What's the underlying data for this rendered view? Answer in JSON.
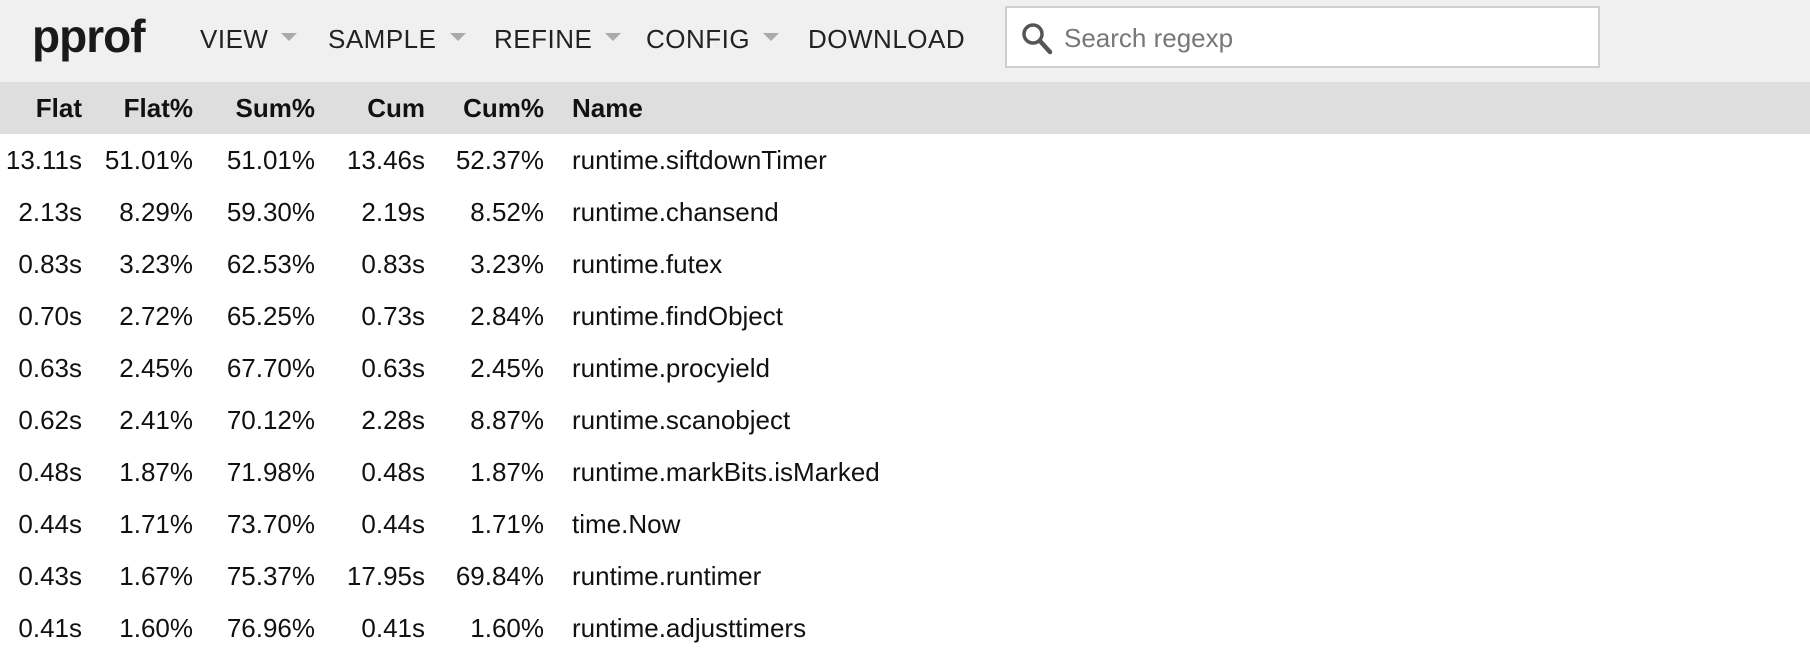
{
  "app": {
    "logo": "pprof"
  },
  "menu": {
    "view": "VIEW",
    "sample": "SAMPLE",
    "refine": "REFINE",
    "config": "CONFIG",
    "download": "DOWNLOAD"
  },
  "search": {
    "placeholder": "Search regexp",
    "value": ""
  },
  "table": {
    "headers": {
      "flat": "Flat",
      "flat_pct": "Flat%",
      "sum_pct": "Sum%",
      "cum": "Cum",
      "cum_pct": "Cum%",
      "name": "Name"
    },
    "rows": [
      {
        "flat": "13.11s",
        "flat_pct": "51.01%",
        "sum_pct": "51.01%",
        "cum": "13.46s",
        "cum_pct": "52.37%",
        "name": "runtime.siftdownTimer"
      },
      {
        "flat": "2.13s",
        "flat_pct": "8.29%",
        "sum_pct": "59.30%",
        "cum": "2.19s",
        "cum_pct": "8.52%",
        "name": "runtime.chansend"
      },
      {
        "flat": "0.83s",
        "flat_pct": "3.23%",
        "sum_pct": "62.53%",
        "cum": "0.83s",
        "cum_pct": "3.23%",
        "name": "runtime.futex"
      },
      {
        "flat": "0.70s",
        "flat_pct": "2.72%",
        "sum_pct": "65.25%",
        "cum": "0.73s",
        "cum_pct": "2.84%",
        "name": "runtime.findObject"
      },
      {
        "flat": "0.63s",
        "flat_pct": "2.45%",
        "sum_pct": "67.70%",
        "cum": "0.63s",
        "cum_pct": "2.45%",
        "name": "runtime.procyield"
      },
      {
        "flat": "0.62s",
        "flat_pct": "2.41%",
        "sum_pct": "70.12%",
        "cum": "2.28s",
        "cum_pct": "8.87%",
        "name": "runtime.scanobject"
      },
      {
        "flat": "0.48s",
        "flat_pct": "1.87%",
        "sum_pct": "71.98%",
        "cum": "0.48s",
        "cum_pct": "1.87%",
        "name": "runtime.markBits.isMarked"
      },
      {
        "flat": "0.44s",
        "flat_pct": "1.71%",
        "sum_pct": "73.70%",
        "cum": "0.44s",
        "cum_pct": "1.71%",
        "name": "time.Now"
      },
      {
        "flat": "0.43s",
        "flat_pct": "1.67%",
        "sum_pct": "75.37%",
        "cum": "17.95s",
        "cum_pct": "69.84%",
        "name": "runtime.runtimer"
      },
      {
        "flat": "0.41s",
        "flat_pct": "1.60%",
        "sum_pct": "76.96%",
        "cum": "0.41s",
        "cum_pct": "1.60%",
        "name": "runtime.adjusttimers"
      }
    ]
  },
  "icons": {
    "search": "search-icon",
    "dropdown": "caret-down-icon"
  },
  "colors": {
    "topbar_bg": "#f0f0f0",
    "header_bg": "#dedede",
    "caret": "#aaaaaa"
  }
}
